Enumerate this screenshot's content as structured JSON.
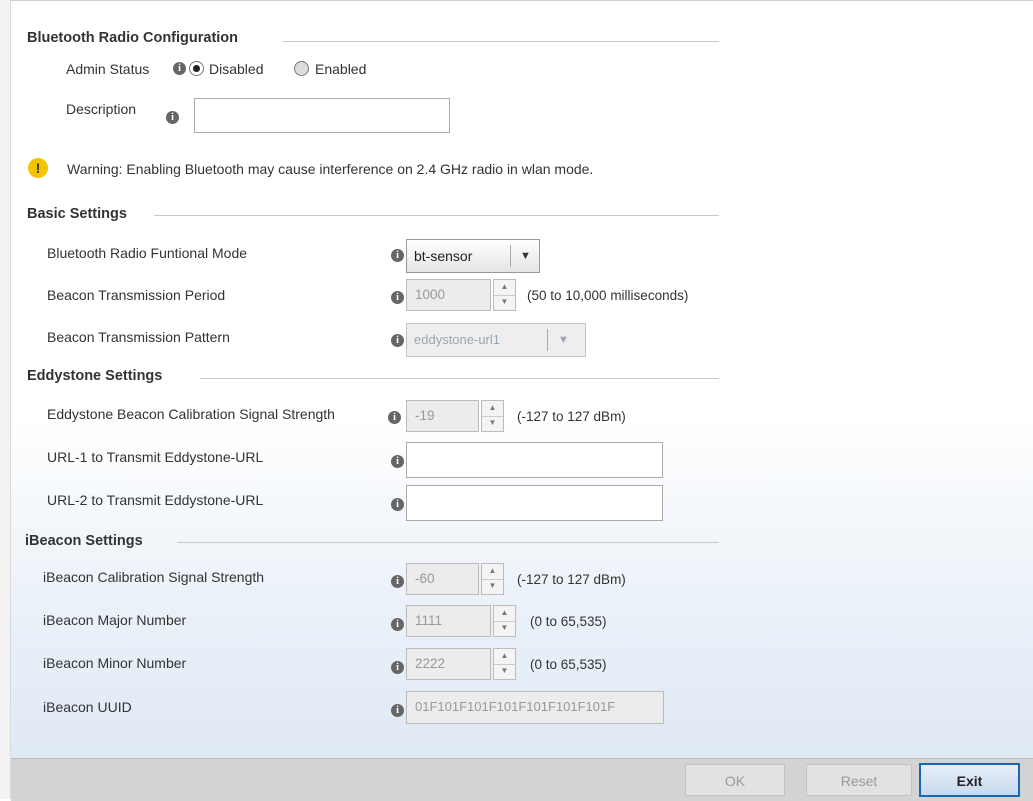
{
  "bluetooth_radio": {
    "title": "Bluetooth Radio Configuration",
    "admin_status_label": "Admin Status",
    "disabled_label": "Disabled",
    "enabled_label": "Enabled",
    "admin_status_value": "Disabled",
    "description_label": "Description",
    "description_value": ""
  },
  "warning": {
    "text": "Warning: Enabling Bluetooth may cause interference on 2.4 GHz radio in wlan mode.",
    "icon": "warning-icon"
  },
  "basic": {
    "title": "Basic Settings",
    "mode_label": "Bluetooth Radio Funtional Mode",
    "mode_value": "bt-sensor",
    "period_label": "Beacon Transmission Period",
    "period_value": "1000",
    "period_hint": "(50 to 10,000 milliseconds)",
    "pattern_label": "Beacon Transmission Pattern",
    "pattern_value": "eddystone-url1"
  },
  "eddystone": {
    "title": "Eddystone Settings",
    "calibration_label": "Eddystone Beacon Calibration Signal Strength",
    "calibration_value": "-19",
    "calibration_hint": "(-127 to 127 dBm)",
    "url1_label": "URL-1 to Transmit Eddystone-URL",
    "url1_value": "",
    "url2_label": "URL-2 to Transmit Eddystone-URL",
    "url2_value": ""
  },
  "ibeacon": {
    "title": "iBeacon Settings",
    "calibration_label": "iBeacon Calibration Signal Strength",
    "calibration_value": "-60",
    "calibration_hint": "(-127 to 127 dBm)",
    "major_label": "iBeacon Major Number",
    "major_value": "1111",
    "major_hint": "(0 to 65,535)",
    "minor_label": "iBeacon Minor Number",
    "minor_value": "2222",
    "minor_hint": "(0 to 65,535)",
    "uuid_label": "iBeacon UUID",
    "uuid_value": "01F101F101F101F101F101F101F"
  },
  "footer": {
    "ok_label": "OK",
    "reset_label": "Reset",
    "exit_label": "Exit"
  },
  "colors": {
    "primary_button_border": "#1b66b2",
    "warning_icon": "#f2c300",
    "info_icon": "#666666"
  }
}
